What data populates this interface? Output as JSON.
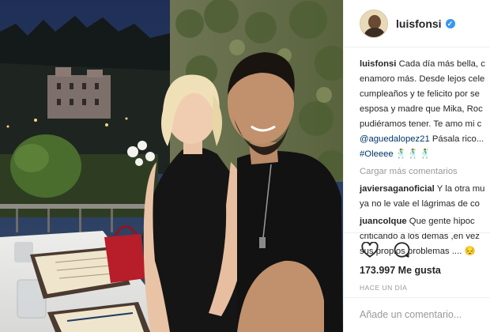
{
  "post": {
    "username": "luisfonsi",
    "verified_mark": "✓",
    "caption": {
      "username": "luisfonsi",
      "lines": [
        "Cada día más bella, c",
        "enamoro más. Desde lejos cele",
        "cumpleaños y te felicito por se",
        "esposa y madre que Mika, Roc",
        "pudiéramos tener. Te amo mi c"
      ],
      "mention": "@aguedalopez21",
      "mention_tail": " Pásala rico...",
      "hashtag": "#Oleeee",
      "hashtag_emoji": "🕺🕺🕺"
    },
    "load_more": "Cargar más comentarios",
    "comments": [
      {
        "username": "javiersaganoficial",
        "first": " Y la otra mu",
        "second": "ya no le vale el lágrimas de co"
      },
      {
        "username": "juancolque",
        "first": " Que gente hipoc",
        "second": "criticando a los demas ,en vez",
        "third": "sus propios problemas .... 😔"
      }
    ],
    "likes": "173.997 Me gusta",
    "time_ago": "HACE UN DÍA",
    "add_comment_placeholder": "Añade un comentario..."
  },
  "icons": [
    "heart-icon",
    "comment-icon"
  ],
  "colors": {
    "link": "#003569",
    "verified": "#3897f0",
    "muted": "#999999",
    "text": "#262626"
  }
}
